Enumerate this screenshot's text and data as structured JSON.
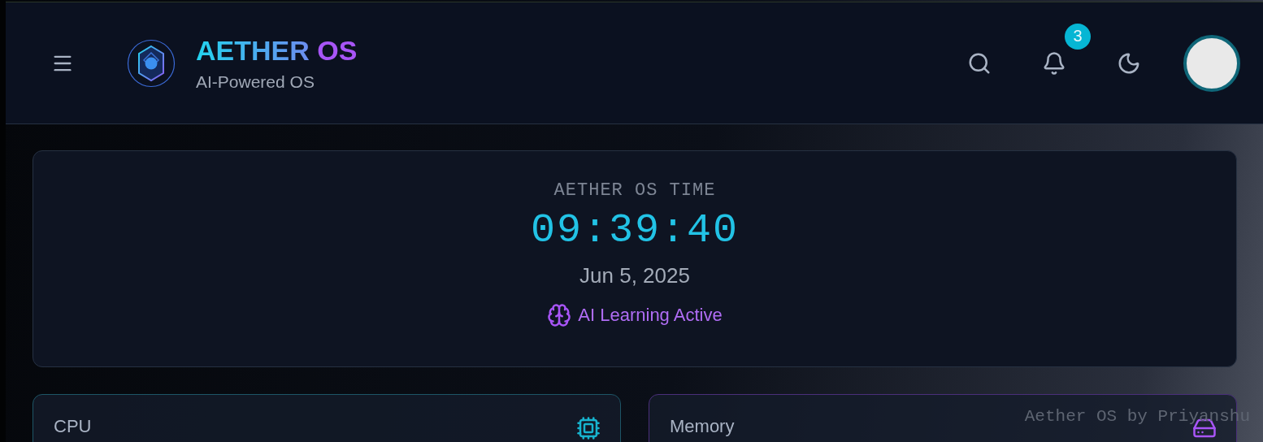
{
  "header": {
    "title_main": "AETHER",
    "title_accent": "OS",
    "subtitle": "AI-Powered OS",
    "notifications": {
      "count": "3"
    }
  },
  "clock": {
    "label": "AETHER OS TIME",
    "time": "09:39:40",
    "date": "Jun 5, 2025",
    "status": "AI Learning Active"
  },
  "cards": [
    {
      "title": "CPU",
      "kind": "cpu"
    },
    {
      "title": "Memory",
      "kind": "memory"
    }
  ],
  "credit": "Aether OS by Priyanshu"
}
